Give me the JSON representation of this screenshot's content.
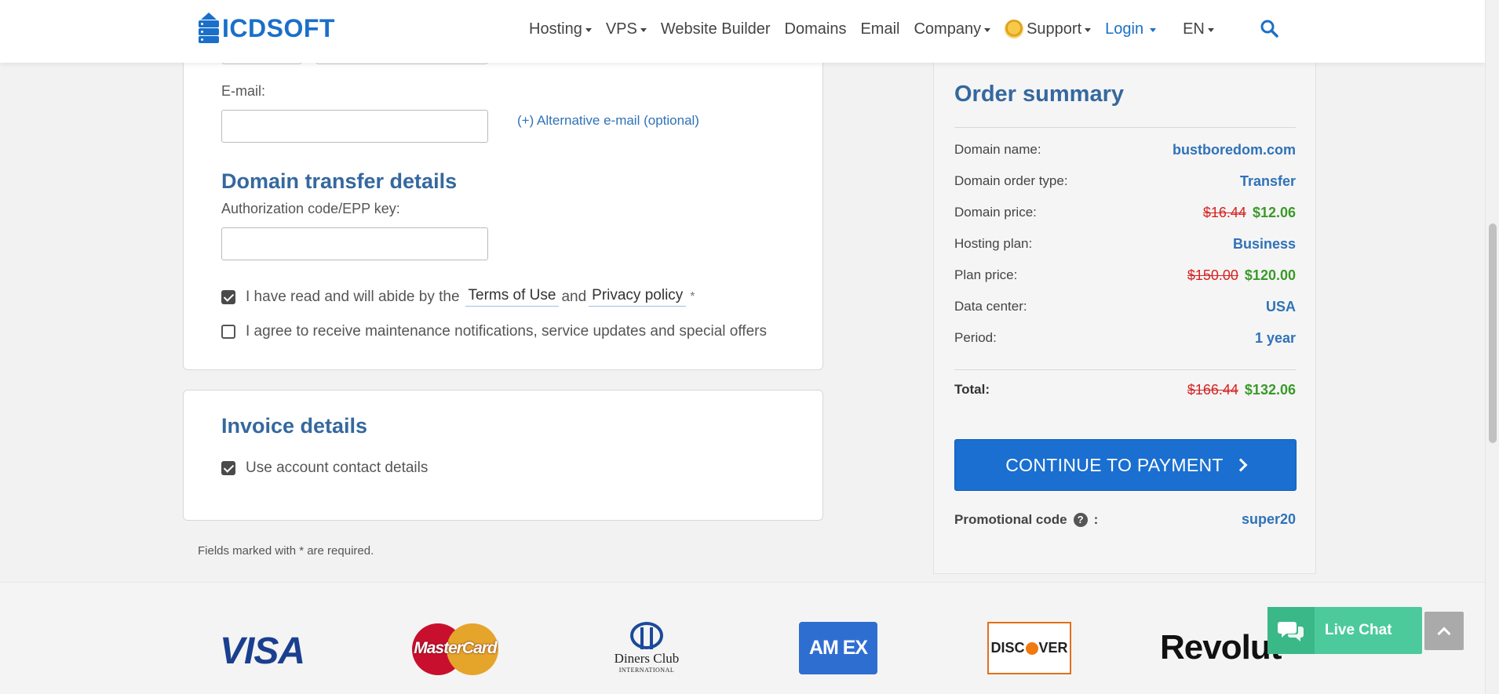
{
  "header": {
    "logo_text": "ICDSOFT",
    "nav": [
      {
        "label": "Hosting",
        "has_caret": true
      },
      {
        "label": "VPS",
        "has_caret": true
      },
      {
        "label": "Website Builder",
        "has_caret": false
      },
      {
        "label": "Domains",
        "has_caret": false
      },
      {
        "label": "Email",
        "has_caret": false
      },
      {
        "label": "Company",
        "has_caret": true
      },
      {
        "label": "Support",
        "has_caret": true
      },
      {
        "label": "Login",
        "has_caret": true
      },
      {
        "label": "EN",
        "has_caret": true
      }
    ]
  },
  "form": {
    "email_label": "E-mail:",
    "email_value": "",
    "alt_email_link": "(+) Alternative e-mail (optional)",
    "transfer_title": "Domain transfer details",
    "auth_label": "Authorization code/EPP key:",
    "auth_value": "",
    "terms_prefix": "I have read and will abide by the",
    "terms_link": "Terms of Use",
    "terms_and": "and",
    "privacy_link": "Privacy policy",
    "required_mark": "*",
    "terms_checked": true,
    "marketing_label": "I agree to receive maintenance notifications, service updates and special offers",
    "marketing_checked": false,
    "invoice_title": "Invoice details",
    "use_account_label": "Use account contact details",
    "use_account_checked": true,
    "footnote": "Fields marked with * are required."
  },
  "summary": {
    "title": "Order summary",
    "rows": [
      {
        "label": "Domain name:",
        "value": "bustboredom.com"
      },
      {
        "label": "Domain order type:",
        "value": "Transfer"
      },
      {
        "label": "Domain price:",
        "old": "$16.44",
        "new": "$12.06"
      },
      {
        "label": "Hosting plan:",
        "value": "Business"
      },
      {
        "label": "Plan price:",
        "old": "$150.00",
        "new": "$120.00"
      },
      {
        "label": "Data center:",
        "value": "USA"
      },
      {
        "label": "Period:",
        "value": "1 year"
      }
    ],
    "total_label": "Total:",
    "total_old": "$166.44",
    "total_new": "$132.06",
    "pay_button": "CONTINUE TO PAYMENT",
    "promo_label": "Promotional code",
    "promo_help": "?",
    "promo_colon": ":",
    "promo_value": "super20"
  },
  "payments": {
    "visa": "VISA",
    "mastercard": "MasterCard",
    "diners_line1": "Diners Club",
    "diners_line2": "INTERNATIONAL",
    "amex": "AM EX",
    "discover_pre": "DISC",
    "discover_post": "VER",
    "revolut": "Revolut"
  },
  "chat": {
    "label": "Live Chat"
  },
  "colors": {
    "brand_blue": "#1a6fc9",
    "heading_blue": "#35689e",
    "old_price_red": "#d62424",
    "new_price_green": "#3a9a2a",
    "chat_green": "#4cca9c"
  }
}
